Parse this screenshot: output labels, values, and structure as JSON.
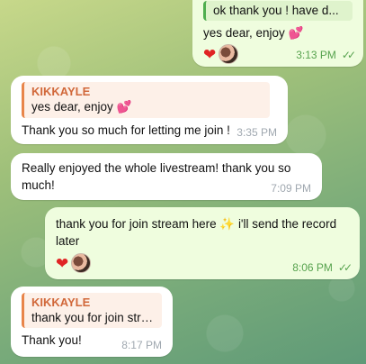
{
  "messages": [
    {
      "reply_text": "ok thank you ! have d...",
      "text": "yes dear, enjoy",
      "text_emoji": "💕",
      "reactions": [
        "❤"
      ],
      "time": "3:13 PM",
      "status": "read"
    },
    {
      "reply_name": "KIKKAYLE",
      "reply_text": "yes dear, enjoy",
      "reply_emoji": "💕",
      "text": "Thank you so much for letting me join !",
      "time": "3:35 PM"
    },
    {
      "text": "Really enjoyed the whole livestream! thank you so much!",
      "time": "7:09 PM"
    },
    {
      "text_a": "thank you for join stream here",
      "text_emoji": "✨",
      "text_b": "i'll send the record later",
      "reactions": [
        "❤"
      ],
      "time": "8:06 PM",
      "status": "read"
    },
    {
      "reply_name": "KIKKAYLE",
      "reply_text": "thank you for join stre...",
      "text": "Thank you!",
      "time": "8:17 PM"
    }
  ],
  "icons": {
    "read": "double-check-icon",
    "reaction": "heart-icon",
    "reactor": "avatar"
  },
  "colors": {
    "outgoing_bubble": "#effdde",
    "incoming_bubble": "#ffffff",
    "reply_accent": "#d1683a",
    "time_outgoing": "#58a34f"
  }
}
